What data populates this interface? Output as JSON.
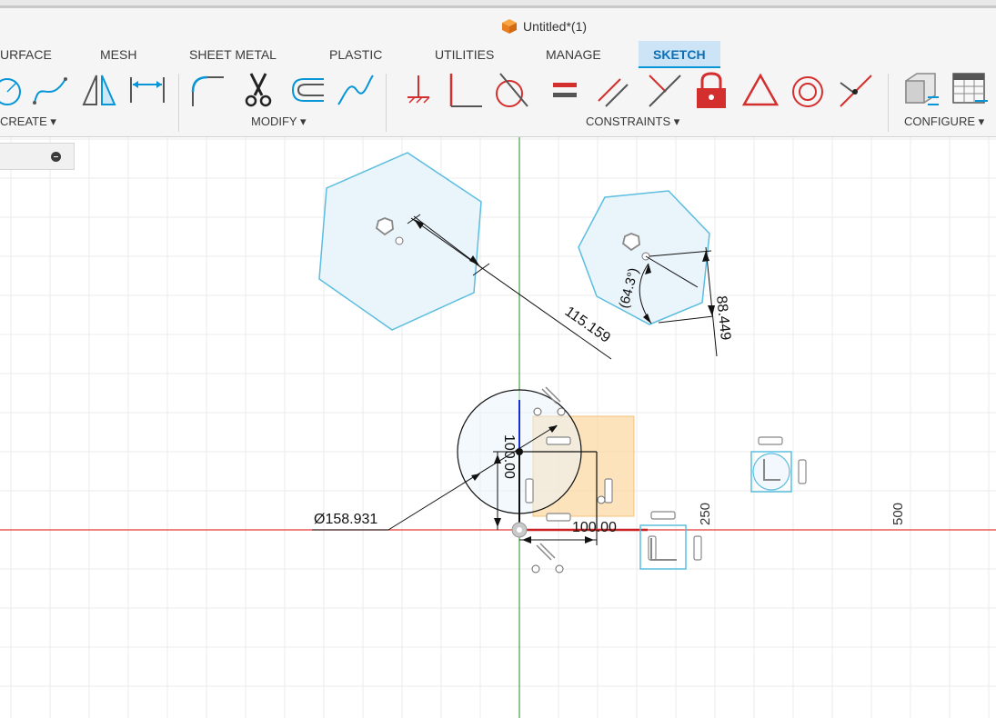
{
  "window": {
    "title": "Untitled*(1)"
  },
  "tabs": [
    {
      "label": "URFACE"
    },
    {
      "label": "MESH"
    },
    {
      "label": "SHEET METAL"
    },
    {
      "label": "PLASTIC"
    },
    {
      "label": "UTILITIES"
    },
    {
      "label": "MANAGE"
    },
    {
      "label": "SKETCH",
      "active": true
    }
  ],
  "toolbar_groups": {
    "create": "CREATE",
    "modify": "MODIFY",
    "constraints": "CONSTRAINTS",
    "configure": "CONFIGURE"
  },
  "tools": {
    "create": [
      "circle-tool",
      "spline-tool",
      "mirror-tool",
      "dimension-tool"
    ],
    "modify": [
      "fillet-tool",
      "trim-tool",
      "offset-tool",
      "extend-tool"
    ],
    "constraints": [
      "fix-tool",
      "perpendicular-tool",
      "tangent-tool",
      "equal-tool",
      "parallel-tool",
      "coincident-tool",
      "lock-tool",
      "triangle-tool",
      "concentric-tool",
      "midpoint-tool"
    ],
    "configure": [
      "configure-part-tool",
      "configure-table-tool"
    ]
  },
  "dimensions": {
    "diameter": "Ø158.931",
    "vertical": "100.00",
    "horizontal": "100.00",
    "distance": "115.159",
    "angle": "(64.3°)",
    "side": "88.449"
  },
  "axis_labels": {
    "tick_250": "250",
    "tick_500": "500"
  },
  "colors": {
    "accent": "#0696d7",
    "active_tab_bg": "#cce4f6",
    "sketch_fill": "#eaf4fb",
    "sketch_line": "#5bbde0",
    "selection": "#fbd9a4",
    "x_axis": "#e53935",
    "y_axis": "#43a047"
  }
}
